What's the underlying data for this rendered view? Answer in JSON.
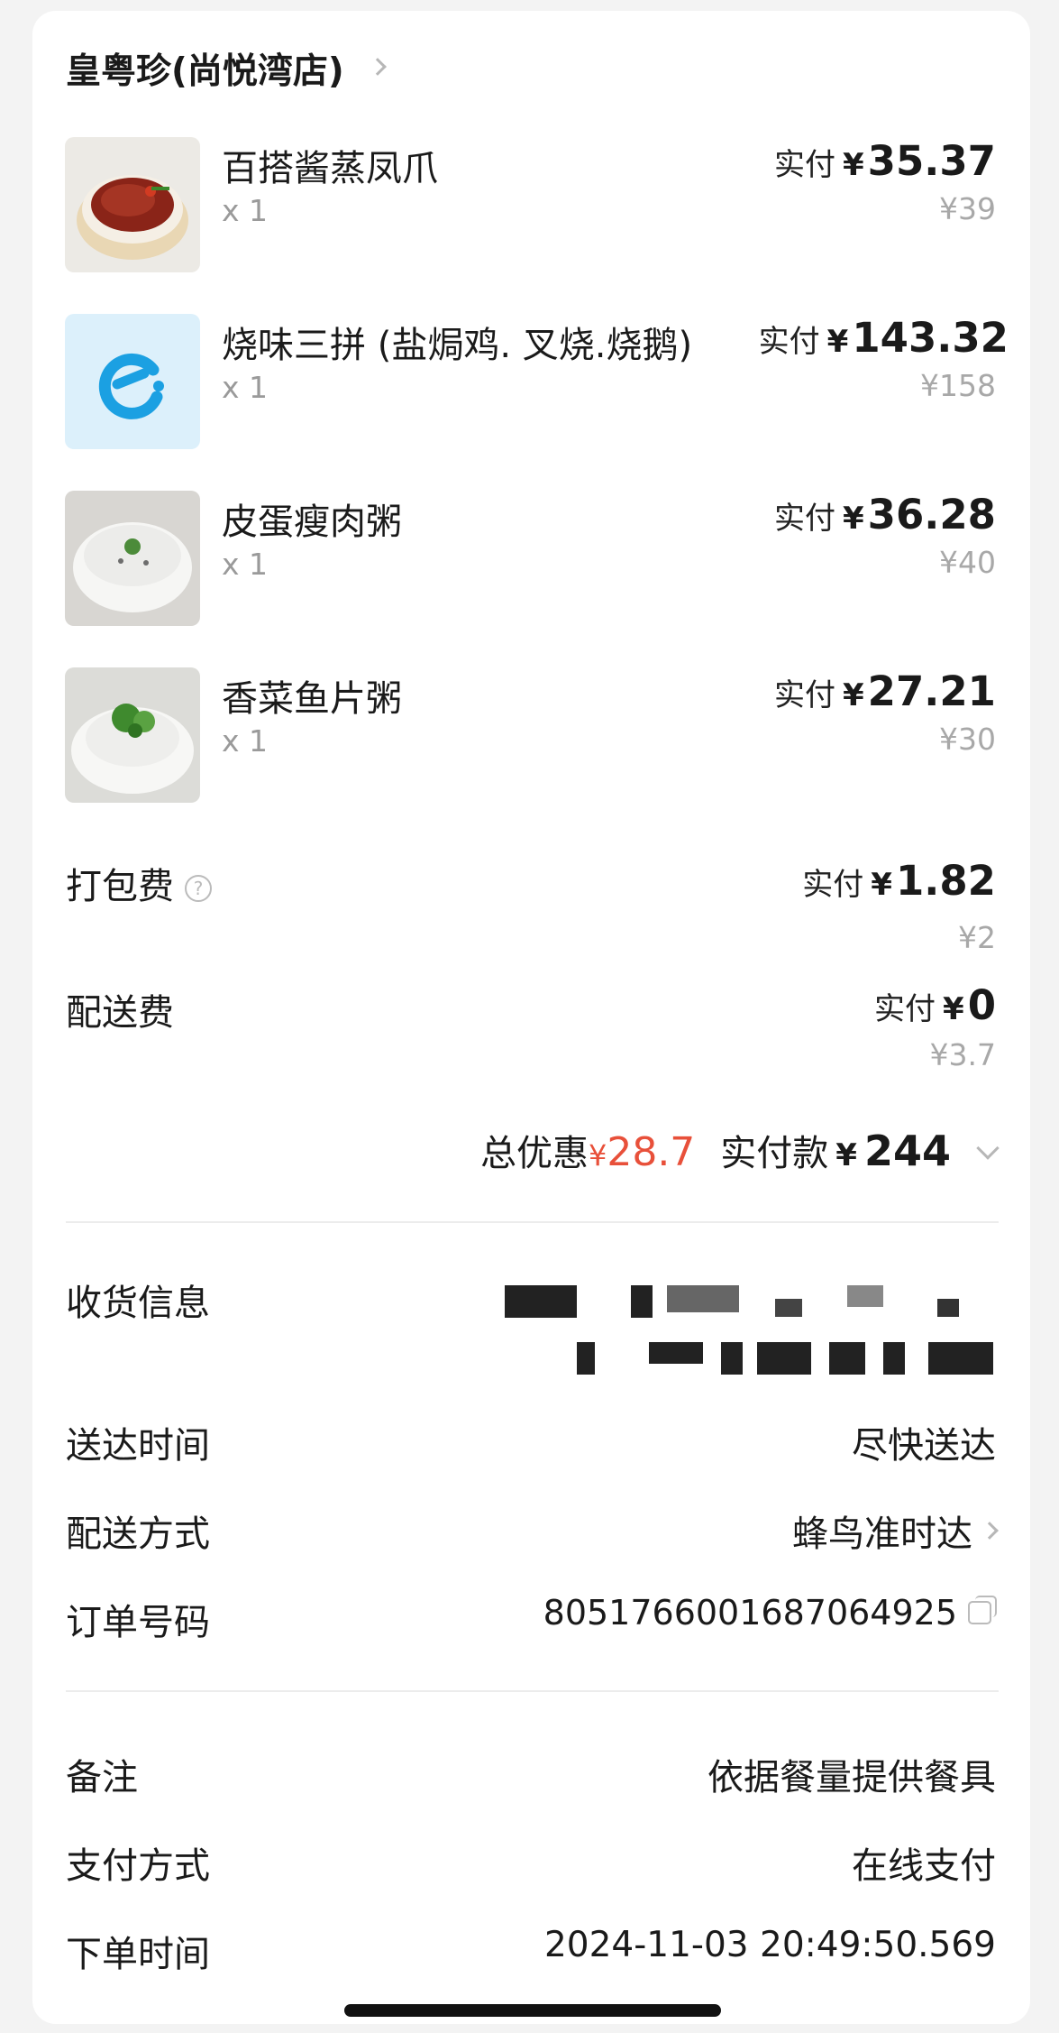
{
  "shop": {
    "name": "皇粤珍(尚悦湾店)"
  },
  "items": [
    {
      "name": "百搭酱蒸凤爪",
      "qty": "x 1",
      "paid_label": "实付",
      "currency": "¥",
      "paid": "35.37",
      "original": "¥39"
    },
    {
      "name": "烧味三拼 (盐焗鸡. 叉烧.烧鹅)",
      "qty": "x 1",
      "paid_label": "实付",
      "currency": "¥",
      "paid": "143.32",
      "original": "¥158"
    },
    {
      "name": "皮蛋瘦肉粥",
      "qty": "x 1",
      "paid_label": "实付",
      "currency": "¥",
      "paid": "36.28",
      "original": "¥40"
    },
    {
      "name": "香菜鱼片粥",
      "qty": "x 1",
      "paid_label": "实付",
      "currency": "¥",
      "paid": "27.21",
      "original": "¥30"
    }
  ],
  "fees": {
    "packing": {
      "label": "打包费",
      "help_icon": "question-circle-icon",
      "paid_label": "实付",
      "currency": "¥",
      "paid": "1.82",
      "original": "¥2"
    },
    "delivery": {
      "label": "配送费",
      "paid_label": "实付",
      "currency": "¥",
      "paid": "0",
      "original": "¥3.7"
    }
  },
  "summary": {
    "discount_label": "总优惠",
    "discount_currency": "¥",
    "discount": "28.7",
    "total_label": "实付款",
    "total_currency": "¥",
    "total": "244"
  },
  "details": {
    "address_label": "收货信息",
    "delivery_time_label": "送达时间",
    "delivery_time": "尽快送达",
    "delivery_method_label": "配送方式",
    "delivery_method": "蜂鸟准时达",
    "order_no_label": "订单号码",
    "order_no": "8051766001687064925"
  },
  "extra": {
    "note_label": "备注",
    "note": "依据餐量提供餐具",
    "payment_label": "支付方式",
    "payment": "在线支付",
    "order_time_label": "下单时间",
    "order_time": "2024-11-03 20:49:50.569"
  },
  "colors": {
    "discount": "#e8503a",
    "eleme_blue": "#1ba0e2"
  }
}
